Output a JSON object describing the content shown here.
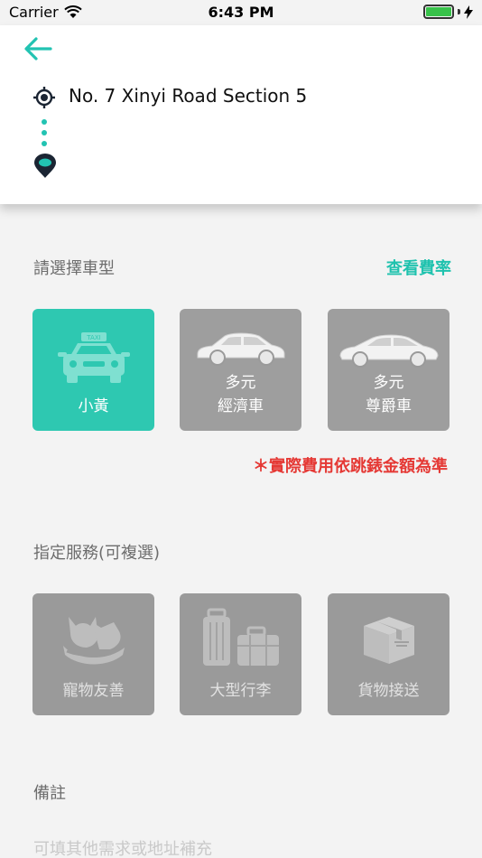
{
  "status": {
    "carrier": "Carrier",
    "time": "6:43 PM"
  },
  "route": {
    "origin": "No. 7 Xinyi Road Section 5",
    "destination": ""
  },
  "vehicle_section": {
    "title": "請選擇車型",
    "rate_link": "查看費率"
  },
  "vehicles": [
    {
      "label": "小黃",
      "selected": true
    },
    {
      "label": "多元\n經濟車",
      "line1": "多元",
      "line2": "經濟車",
      "selected": false
    },
    {
      "label": "多元\n尊爵車",
      "line1": "多元",
      "line2": "尊爵車",
      "selected": false
    }
  ],
  "fare_note": "＊實際費用依跳錶金額為準",
  "services_section": {
    "title": "指定服務(可複選)"
  },
  "services": [
    {
      "label": "寵物友善",
      "icon": "pet-icon"
    },
    {
      "label": "大型行李",
      "icon": "luggage-icon"
    },
    {
      "label": "貨物接送",
      "icon": "package-icon"
    }
  ],
  "remark": {
    "title": "備註",
    "placeholder": "可填其他需求或地址補充"
  },
  "colors": {
    "accent": "#2ec8b1",
    "tile_gray": "#9e9e9e",
    "warning": "#e53935"
  }
}
